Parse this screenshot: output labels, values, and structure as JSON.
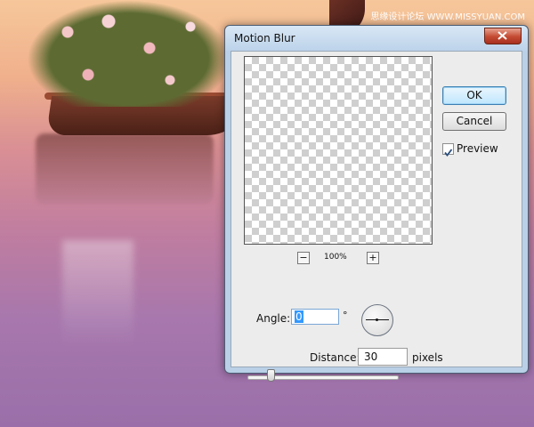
{
  "watermark": "思缘设计论坛 WWW.MISSYUAN.COM",
  "dialog": {
    "title": "Motion Blur",
    "ok_label": "OK",
    "cancel_label": "Cancel",
    "preview_label": "Preview",
    "preview_checked": true,
    "zoom_out_label": "−",
    "zoom_in_label": "+",
    "zoom_level": "100%",
    "angle_label": "Angle:",
    "angle_value": "0",
    "angle_unit": "°",
    "distance_label": "Distance:",
    "distance_value": "30",
    "distance_unit": "pixels"
  },
  "icons": {
    "close": "close-icon",
    "check": "check-icon",
    "dial": "angle-dial-icon"
  },
  "colors": {
    "accent": "#3399ff",
    "close_button": "#c44a32"
  }
}
